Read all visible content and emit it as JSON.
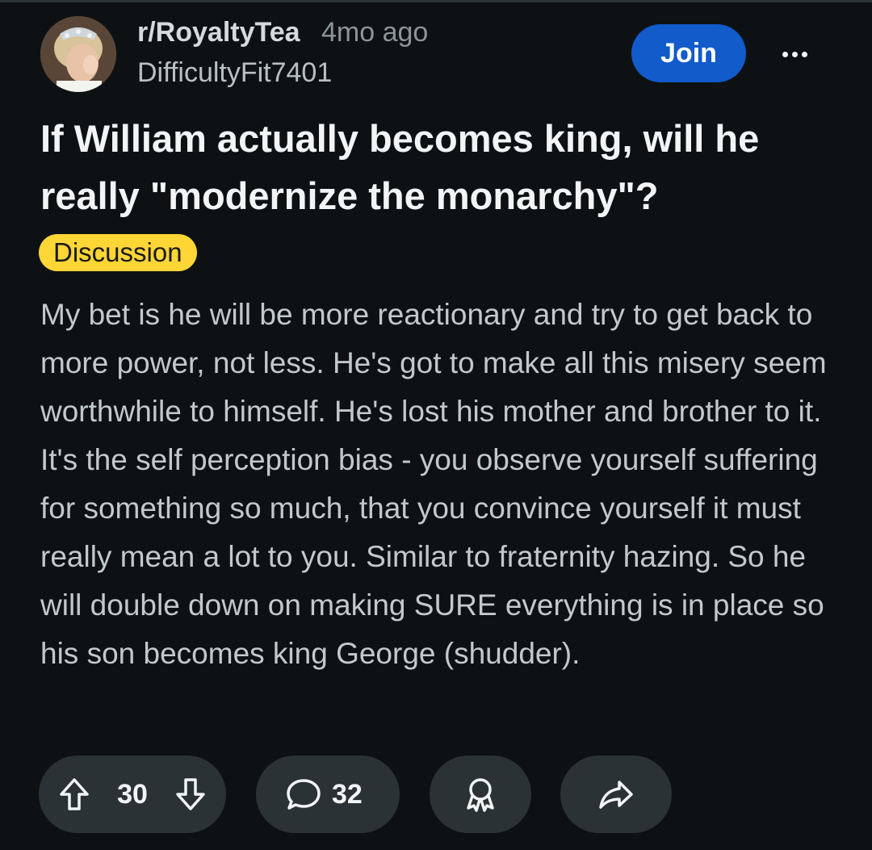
{
  "post": {
    "subreddit": "r/RoyaltyTea",
    "age": "4mo ago",
    "author": "DifficultyFit7401",
    "join_label": "Join",
    "title": "If William actually becomes king, will he really \"modernize the monarchy\"?",
    "flair": "Discussion",
    "body": "My bet is he will be more reactionary and try to get back to more power, not less. He's got to make all this misery seem worthwhile to himself. He's lost his mother and brother to it. It's the self perception bias - you observe yourself suffering for something so much, that you convince yourself it must really mean a lot to you. Similar to fraternity hazing. So he will double down on making SURE everything is in place so his son becomes king George (shudder)."
  },
  "actions": {
    "vote_count": "30",
    "comment_count": "32"
  },
  "colors": {
    "background": "#0e1113",
    "join_button": "#115bca",
    "flair": "#ffd635",
    "pill": "#2a3236"
  },
  "icons": {
    "upvote": "upvote-icon",
    "downvote": "downvote-icon",
    "comment": "comment-icon",
    "award": "award-icon",
    "share": "share-icon",
    "more": "more-options-icon"
  }
}
